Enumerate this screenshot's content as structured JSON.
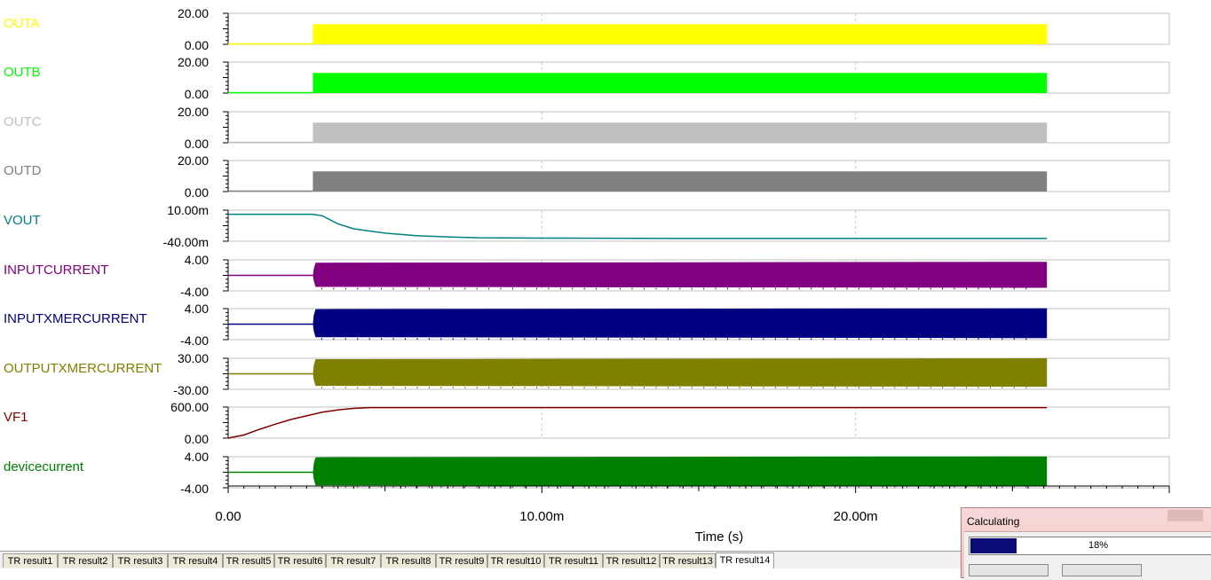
{
  "chart_data": {
    "type": "line",
    "xlabel": "Time (s)",
    "x_ticks": [
      "0.00",
      "10.00m",
      "20.00m"
    ],
    "xlim": [
      0,
      0.03
    ],
    "grid_x": [
      0.01,
      0.02
    ],
    "series": [
      {
        "name": "OUTA",
        "color": "#ffff00",
        "y_ticks": [
          "20.00",
          "0.00"
        ],
        "ylim": [
          0,
          20
        ],
        "shape": "pulse",
        "pre_value": 0,
        "switch_time": 0.0027,
        "band": [
          0,
          13
        ],
        "end_time": 0.0261
      },
      {
        "name": "OUTB",
        "color": "#00ff00",
        "y_ticks": [
          "20.00",
          "0.00"
        ],
        "ylim": [
          0,
          20
        ],
        "shape": "pulse",
        "pre_value": 0,
        "switch_time": 0.0027,
        "band": [
          0,
          13
        ],
        "end_time": 0.0261
      },
      {
        "name": "OUTC",
        "color": "#c0c0c0",
        "y_ticks": [
          "20.00",
          "0.00"
        ],
        "ylim": [
          0,
          20
        ],
        "shape": "pulse",
        "pre_value": 0,
        "switch_time": 0.0027,
        "band": [
          0,
          13
        ],
        "end_time": 0.0261
      },
      {
        "name": "OUTD",
        "color": "#808080",
        "y_ticks": [
          "20.00",
          "0.00"
        ],
        "ylim": [
          0,
          20
        ],
        "shape": "pulse",
        "pre_value": 0,
        "switch_time": 0.0027,
        "band": [
          0,
          13
        ],
        "end_time": 0.0261
      },
      {
        "name": "VOUT",
        "color": "#008080",
        "y_ticks": [
          "10.00m",
          "-40.00m"
        ],
        "ylim": [
          -0.04,
          0.01
        ],
        "shape": "line",
        "points": [
          [
            0,
            0.0035
          ],
          [
            0.0027,
            0.0035
          ],
          [
            0.003,
            0.001
          ],
          [
            0.0035,
            -0.012
          ],
          [
            0.004,
            -0.02
          ],
          [
            0.005,
            -0.027
          ],
          [
            0.006,
            -0.031
          ],
          [
            0.007,
            -0.033
          ],
          [
            0.008,
            -0.0345
          ],
          [
            0.01,
            -0.035
          ],
          [
            0.015,
            -0.0355
          ],
          [
            0.0261,
            -0.0355
          ]
        ]
      },
      {
        "name": "INPUTCURRENT",
        "color": "#800080",
        "y_ticks": [
          "4.00",
          "-4.00"
        ],
        "ylim": [
          -4,
          4
        ],
        "shape": "oscillation",
        "pre_value": 0,
        "switch_time": 0.0027,
        "band": [
          -3.2,
          3.5
        ],
        "end_time": 0.0261
      },
      {
        "name": "INPUTXMERCURRENT",
        "color": "#000080",
        "y_ticks": [
          "4.00",
          "-4.00"
        ],
        "ylim": [
          -4,
          4
        ],
        "shape": "oscillation",
        "pre_value": 0,
        "switch_time": 0.0027,
        "band": [
          -3.6,
          4.1
        ],
        "end_time": 0.0261
      },
      {
        "name": "OUTPUTXMERCURRENT",
        "color": "#808000",
        "y_ticks": [
          "30.00",
          "-30.00"
        ],
        "ylim": [
          -30,
          30
        ],
        "shape": "oscillation",
        "pre_value": 0,
        "switch_time": 0.0027,
        "band": [
          -25,
          30
        ],
        "end_time": 0.0261
      },
      {
        "name": "VF1",
        "color": "#800000",
        "y_ticks": [
          "600.00",
          "0.00"
        ],
        "ylim": [
          0,
          600
        ],
        "shape": "line",
        "points": [
          [
            0,
            0
          ],
          [
            0.0005,
            60
          ],
          [
            0.001,
            170
          ],
          [
            0.0015,
            270
          ],
          [
            0.002,
            360
          ],
          [
            0.0025,
            430
          ],
          [
            0.003,
            500
          ],
          [
            0.0035,
            545
          ],
          [
            0.004,
            575
          ],
          [
            0.0045,
            590
          ],
          [
            0.005,
            590
          ],
          [
            0.0261,
            590
          ]
        ]
      },
      {
        "name": "devicecurrent",
        "color": "#008000",
        "y_ticks": [
          "4.00",
          "-4.00"
        ],
        "ylim": [
          -4,
          4
        ],
        "shape": "oscillation",
        "pre_value": 0,
        "switch_time": 0.0027,
        "band": [
          -3.6,
          4.1
        ],
        "end_time": 0.0261
      }
    ]
  },
  "tabs": [
    {
      "label": "TR result1"
    },
    {
      "label": "TR result2"
    },
    {
      "label": "TR result3"
    },
    {
      "label": "TR result4"
    },
    {
      "label": "TR result5"
    },
    {
      "label": "TR result6"
    },
    {
      "label": "TR result7"
    },
    {
      "label": "TR result8"
    },
    {
      "label": "TR result9"
    },
    {
      "label": "TR result10"
    },
    {
      "label": "TR result11"
    },
    {
      "label": "TR result12"
    },
    {
      "label": "TR result13"
    },
    {
      "label": "TR result14"
    }
  ],
  "active_tab": 13,
  "dialog": {
    "title": "Calculating",
    "progress_text": "18%",
    "progress": 0.18
  }
}
